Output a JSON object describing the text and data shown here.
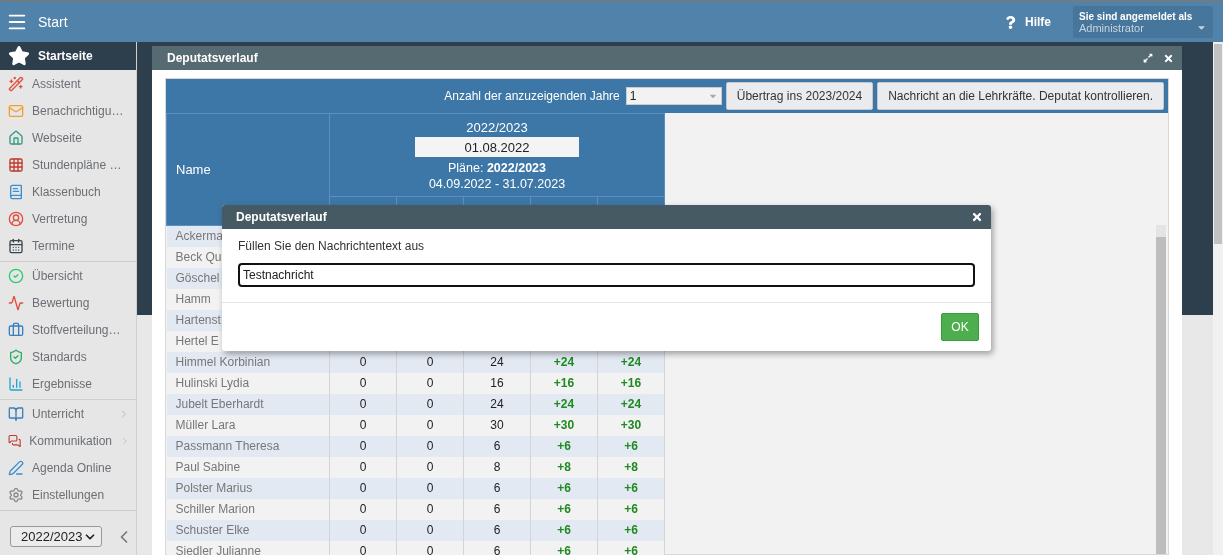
{
  "top_bar": {
    "title": "Start",
    "help": "Hilfe",
    "login": {
      "label": "Sie sind angemeldet als",
      "user": "Administrator"
    }
  },
  "sidebar": {
    "groups": [
      [
        {
          "label": "Startseite",
          "selected": true,
          "submenu": false
        },
        {
          "label": "Assistent",
          "selected": false,
          "submenu": false
        },
        {
          "label": "Benachrichtigu…",
          "selected": false,
          "submenu": false
        },
        {
          "label": "Webseite",
          "selected": false,
          "submenu": false
        },
        {
          "label": "Stundenpläne …",
          "selected": false,
          "submenu": false
        },
        {
          "label": "Klassenbuch",
          "selected": false,
          "submenu": false
        },
        {
          "label": "Vertretung",
          "selected": false,
          "submenu": false
        },
        {
          "label": "Termine",
          "selected": false,
          "submenu": false
        }
      ],
      [
        {
          "label": "Übersicht",
          "selected": false,
          "submenu": false
        },
        {
          "label": "Bewertung",
          "selected": false,
          "submenu": false
        },
        {
          "label": "Stoffverteilung…",
          "selected": false,
          "submenu": false
        },
        {
          "label": "Standards",
          "selected": false,
          "submenu": false
        },
        {
          "label": "Ergebnisse",
          "selected": false,
          "submenu": false
        }
      ],
      [
        {
          "label": "Unterricht",
          "selected": false,
          "submenu": true
        },
        {
          "label": "Kommunikation",
          "selected": false,
          "submenu": true
        },
        {
          "label": "Agenda Online",
          "selected": false,
          "submenu": false
        },
        {
          "label": "Einstellungen",
          "selected": false,
          "submenu": false
        }
      ]
    ],
    "year_select": "2022/2023"
  },
  "window": {
    "title": "Deputatsverlauf",
    "toolbar": {
      "years_label": "Anzahl der anzuzeigenden Jahre",
      "years_value": "1",
      "buttons": [
        "Übertrag ins 2023/2024",
        "Nachricht an die Lehrkräfte. Deputat kontrollieren."
      ]
    },
    "table": {
      "name_header": "Name",
      "year": "2022/2023",
      "date": "01.08.2022",
      "plans_label": "Pläne: **2022/2023**",
      "period": "04.09.2022 - 31.07.2023",
      "columns": [
        {
          "kind": "count"
        },
        {
          "kind": "count"
        },
        {
          "kind": "count"
        },
        {
          "kind": "delta"
        },
        {
          "kind": "delta"
        }
      ],
      "rows": [
        {
          "name": "Ackerma"
        },
        {
          "name": "Beck Qu"
        },
        {
          "name": "Göschel"
        },
        {
          "name": "Hamm"
        },
        {
          "name": "Hartenst"
        },
        {
          "name": "Hertel E"
        },
        {
          "name": "Himmel Korbinian",
          "values": [
            "0",
            "0",
            "24",
            "+24",
            "+24"
          ]
        },
        {
          "name": "Hulinski Lydia",
          "values": [
            "0",
            "0",
            "16",
            "+16",
            "+16"
          ]
        },
        {
          "name": "Jubelt Eberhardt",
          "values": [
            "0",
            "0",
            "24",
            "+24",
            "+24"
          ]
        },
        {
          "name": "Müller Lara",
          "values": [
            "0",
            "0",
            "30",
            "+30",
            "+30"
          ]
        },
        {
          "name": "Passmann Theresa",
          "values": [
            "0",
            "0",
            "6",
            "+6",
            "+6"
          ]
        },
        {
          "name": "Paul Sabine",
          "values": [
            "0",
            "0",
            "8",
            "+8",
            "+8"
          ]
        },
        {
          "name": "Polster Marius",
          "values": [
            "0",
            "0",
            "6",
            "+6",
            "+6"
          ]
        },
        {
          "name": "Schiller Marion",
          "values": [
            "0",
            "0",
            "6",
            "+6",
            "+6"
          ]
        },
        {
          "name": "Schuster Elke",
          "values": [
            "0",
            "0",
            "6",
            "+6",
            "+6"
          ]
        },
        {
          "name": "Siedler Julianne",
          "values": [
            "0",
            "0",
            "6",
            "+6",
            "+6"
          ]
        }
      ]
    }
  },
  "dialog": {
    "title": "Deputatsverlauf",
    "prompt": "Füllen Sie den Nachrichtentext aus",
    "value": "Testnachricht",
    "ok": "OK"
  }
}
